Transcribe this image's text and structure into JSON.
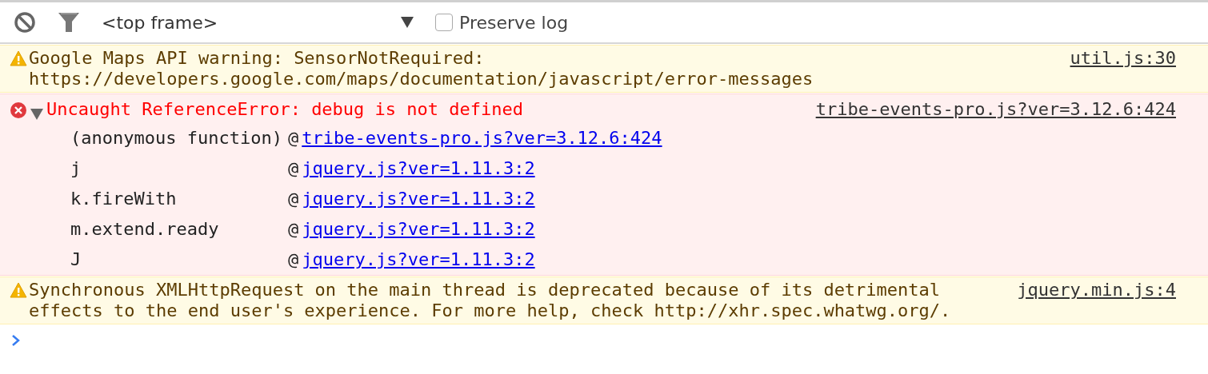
{
  "toolbar": {
    "context": "<top frame>",
    "preserve_log": {
      "label": "Preserve log",
      "checked": false
    }
  },
  "messages": [
    {
      "kind": "warning",
      "text": "Google Maps API warning: SensorNotRequired:\nhttps://developers.google.com/maps/documentation/javascript/error-messages",
      "source": "util.js:30"
    },
    {
      "kind": "error",
      "expanded": true,
      "text": "Uncaught ReferenceError: debug is not defined",
      "source": "tribe-events-pro.js?ver=3.12.6:424",
      "stack": [
        {
          "function": "(anonymous function)",
          "at": "@",
          "link": "tribe-events-pro.js?ver=3.12.6:424"
        },
        {
          "function": "j",
          "at": "@",
          "link": "jquery.js?ver=1.11.3:2"
        },
        {
          "function": "k.fireWith",
          "at": "@",
          "link": "jquery.js?ver=1.11.3:2"
        },
        {
          "function": "m.extend.ready",
          "at": "@",
          "link": "jquery.js?ver=1.11.3:2"
        },
        {
          "function": "J",
          "at": "@",
          "link": "jquery.js?ver=1.11.3:2"
        }
      ]
    },
    {
      "kind": "warning",
      "text": "Synchronous XMLHttpRequest on the main thread is deprecated because of its detrimental effects to the end user's experience. For more help, check http://xhr.spec.whatwg.org/.",
      "source": "jquery.min.js:4"
    }
  ]
}
